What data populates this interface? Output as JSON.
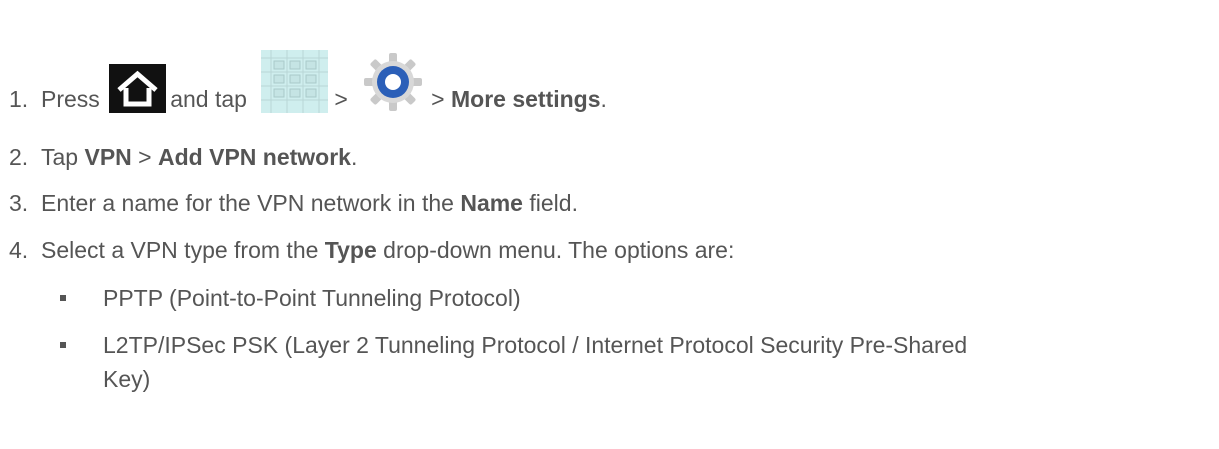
{
  "steps": [
    {
      "number": "1.",
      "t1": "Press",
      "t2": "and tap",
      "t3": ">",
      "t4": ">",
      "bold1": "More settings",
      "end": ".",
      "icons": [
        "home-icon",
        "apps-grid-icon",
        "settings-gear-icon"
      ]
    },
    {
      "number": "2.",
      "t1": "Tap",
      "bold1": "VPN",
      "t2": ">",
      "bold2": "Add VPN network",
      "end": "."
    },
    {
      "number": "3.",
      "t1": "Enter a name for the VPN network in the",
      "bold1": "Name",
      "end": "field."
    },
    {
      "number": "4.",
      "t1": "Select a VPN type from the",
      "bold1": "Type",
      "end": "drop-down menu. The options are:"
    }
  ],
  "options": [
    {
      "line1": "PPTP (Point-to-Point Tunneling Protocol)"
    },
    {
      "line1": "L2TP/IPSec PSK (Layer 2 Tunneling Protocol / Internet Protocol Security Pre-Shared",
      "line2": "Key)"
    }
  ]
}
